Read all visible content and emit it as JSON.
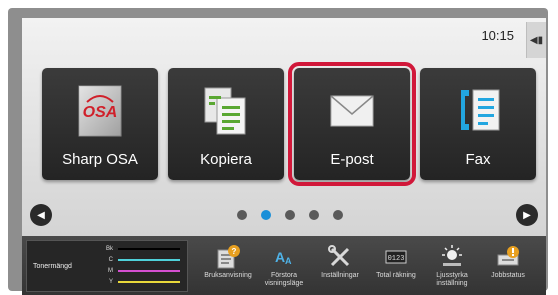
{
  "status": {
    "time": "10:15"
  },
  "tiles": [
    {
      "label": "Sharp OSA",
      "icon": "sharp-osa-icon"
    },
    {
      "label": "Kopiera",
      "icon": "copy-icon"
    },
    {
      "label": "E-post",
      "icon": "envelope-icon",
      "selected": true
    },
    {
      "label": "Fax",
      "icon": "fax-icon"
    }
  ],
  "pagination": {
    "pages": 5,
    "current": 1
  },
  "toner": {
    "title": "Tonermängd",
    "rows": [
      {
        "name": "Bk",
        "color": "#000000"
      },
      {
        "name": "C",
        "color": "#4fd1d9"
      },
      {
        "name": "M",
        "color": "#d44fd1"
      },
      {
        "name": "Y",
        "color": "#e8d83a"
      }
    ]
  },
  "functions": [
    {
      "label": "Bruksanvisning",
      "icon": "manual-icon"
    },
    {
      "label": "Förstora visningsläge",
      "icon": "enlarge-display-icon"
    },
    {
      "label": "Inställningar",
      "icon": "settings-tools-icon"
    },
    {
      "label": "Total räkning",
      "icon": "counter-icon"
    },
    {
      "label": "Ljusstyrka inställning",
      "icon": "brightness-icon"
    },
    {
      "label": "Jobbstatus",
      "icon": "job-status-icon"
    }
  ]
}
